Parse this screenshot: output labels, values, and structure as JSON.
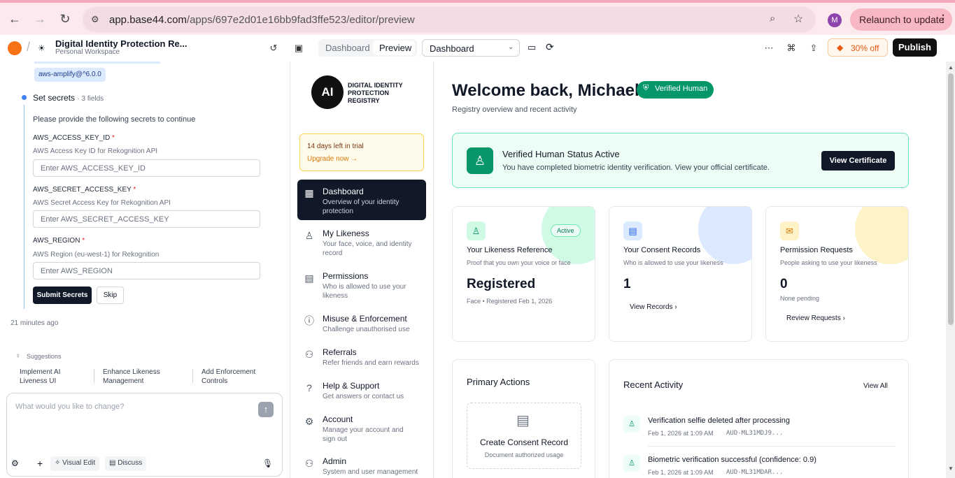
{
  "browser": {
    "url_host": "app.base44.com",
    "url_path": "/apps/697e2d01e16bb9fad3ffe523/editor/preview",
    "avatar": "M",
    "relaunch": "Relaunch to update"
  },
  "header": {
    "app_title": "Digital Identity Protection Re...",
    "workspace": "Personal Workspace",
    "tab_dashboard": "Dashboard",
    "tab_preview": "Preview",
    "page_select": "Dashboard",
    "discount": "30% off",
    "publish": "Publish"
  },
  "chat": {
    "package": "aws-amplify@^6.0.0",
    "step_title": "Set secrets",
    "step_meta": "· 3 fields",
    "prompt": "Please provide the following secrets to continue",
    "fields": [
      {
        "name": "AWS_ACCESS_KEY_ID",
        "desc": "AWS Access Key ID for Rekognition API",
        "placeholder": "Enter AWS_ACCESS_KEY_ID"
      },
      {
        "name": "AWS_SECRET_ACCESS_KEY",
        "desc": "AWS Secret Access Key for Rekognition API",
        "placeholder": "Enter AWS_SECRET_ACCESS_KEY"
      },
      {
        "name": "AWS_REGION",
        "desc": "AWS Region (eu-west-1) for Rekognition",
        "placeholder": "Enter AWS_REGION"
      }
    ],
    "submit": "Submit Secrets",
    "skip": "Skip",
    "time": "21 minutes ago",
    "suggestions_label": "Suggestions",
    "suggestions": [
      "Implement AI Liveness UI",
      "Enhance Likeness Management",
      "Add Enforcement Controls"
    ],
    "input_placeholder": "What would you like to change?",
    "visual_edit": "Visual Edit",
    "discuss": "Discuss"
  },
  "app": {
    "logo": {
      "mark": "AI",
      "line1": "DIGITAL IDENTITY",
      "line2": "PROTECTION",
      "line3": "REGISTRY"
    },
    "trial": {
      "days": "14 days left in trial",
      "upgrade": "Upgrade now →"
    },
    "nav": [
      {
        "title": "Dashboard",
        "desc": "Overview of your identity protection"
      },
      {
        "title": "My Likeness",
        "desc": "Your face, voice, and identity record"
      },
      {
        "title": "Permissions",
        "desc": "Who is allowed to use your likeness"
      },
      {
        "title": "Misuse & Enforcement",
        "desc": "Challenge unauthorised use"
      },
      {
        "title": "Referrals",
        "desc": "Refer friends and earn rewards"
      },
      {
        "title": "Help & Support",
        "desc": "Get answers or contact us"
      },
      {
        "title": "Account",
        "desc": "Manage your account and sign out"
      },
      {
        "title": "Admin",
        "desc": "System and user management"
      }
    ],
    "welcome": "Welcome back, Michael",
    "verified_badge": "Verified Human",
    "subtitle": "Registry overview and recent activity",
    "status": {
      "title": "Verified Human Status Active",
      "desc": "You have completed biometric identity verification. View your official certificate.",
      "button": "View Certificate"
    },
    "cards": [
      {
        "title": "Your Likeness Reference",
        "desc": "Proof that you own your voice or face",
        "value": "Registered",
        "meta": "Face • Registered Feb 1, 2026",
        "badge": "Active",
        "link": ""
      },
      {
        "title": "Your Consent Records",
        "desc": "Who is allowed to use your likeness",
        "value": "1",
        "meta": "",
        "badge": "",
        "link": "View Records"
      },
      {
        "title": "Permission Requests",
        "desc": "People asking to use your likeness",
        "value": "0",
        "meta": "None pending",
        "badge": "",
        "link": "Review Requests"
      }
    ],
    "primary": {
      "title": "Primary Actions",
      "action_title": "Create Consent Record",
      "action_desc": "Document authorized usage"
    },
    "activity": {
      "title": "Recent Activity",
      "view_all": "View All",
      "items": [
        {
          "text": "Verification selfie deleted after processing",
          "time": "Feb 1, 2026 at 1:09 AM",
          "code": "AUD-ML31MDJ9..."
        },
        {
          "text": "Biometric verification successful (confidence: 0.9)",
          "time": "Feb 1, 2026 at 1:09 AM",
          "code": "AUD-ML31MDAR..."
        }
      ]
    }
  }
}
